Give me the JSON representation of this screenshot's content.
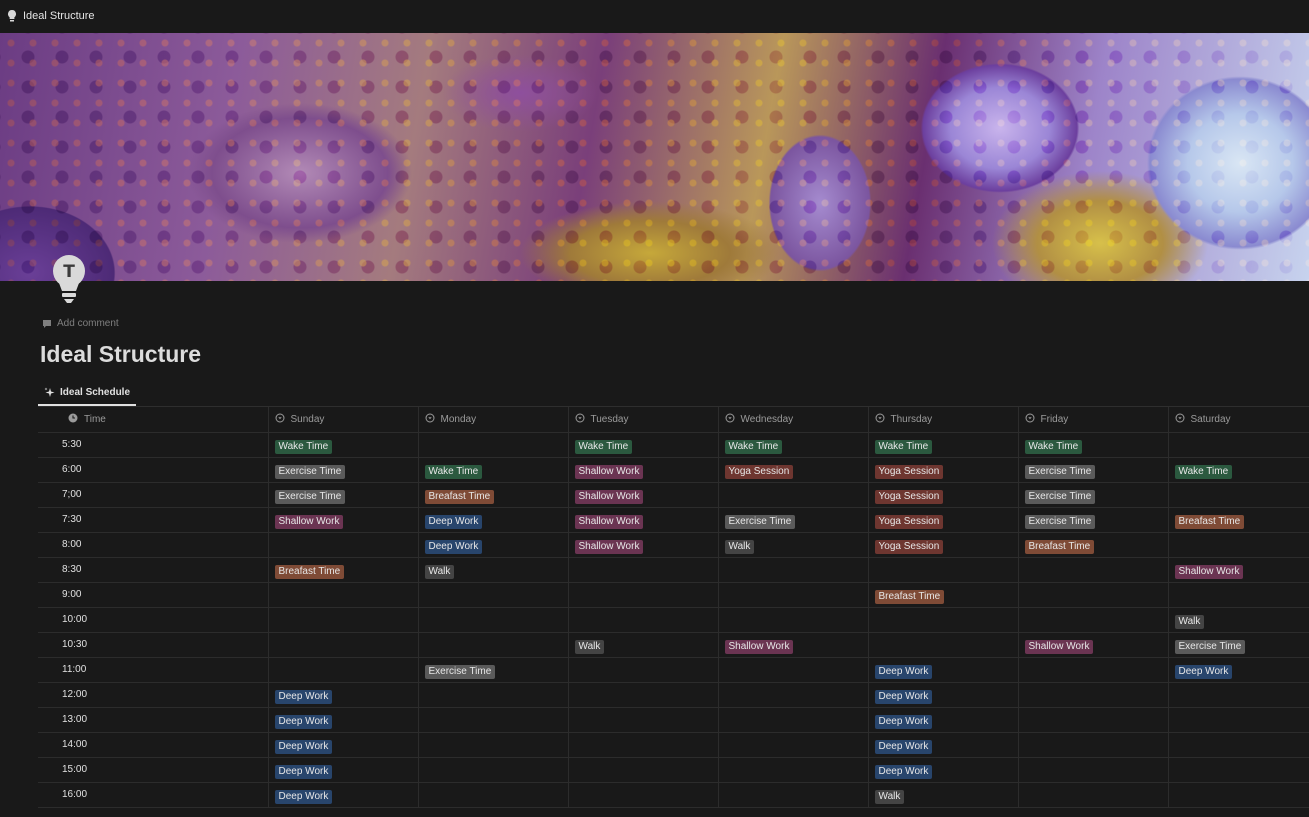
{
  "topbar": {
    "title": "Ideal Structure"
  },
  "page": {
    "icon_letter": "T",
    "add_comment": "Add comment",
    "title": "Ideal Structure",
    "view_tab": "Ideal Schedule"
  },
  "colors": {
    "background": "#191919",
    "Wake Time": "#2b593f",
    "Exercise Time": "#5a5a5a",
    "Shallow Work": "#6b3452",
    "Deep Work": "#28456c",
    "Breafast Time": "#7f4b36",
    "Yoga Session": "#6e3630",
    "Walk": "#444444"
  },
  "table": {
    "columns": [
      "Time",
      "Sunday",
      "Monday",
      "Tuesday",
      "Wednesday",
      "Thursday",
      "Friday",
      "Saturday"
    ],
    "rows": [
      {
        "time": "5:30",
        "cells": [
          "Wake Time",
          "",
          "Wake Time",
          "Wake Time",
          "Wake Time",
          "Wake Time",
          ""
        ]
      },
      {
        "time": "6:00",
        "cells": [
          "Exercise Time",
          "Wake Time",
          "Shallow Work",
          "Yoga Session",
          "Yoga Session",
          "Exercise Time",
          "Wake Time"
        ]
      },
      {
        "time": "7;00",
        "cells": [
          "Exercise Time",
          "Breafast Time",
          "Shallow Work",
          "",
          "Yoga Session",
          "Exercise Time",
          ""
        ]
      },
      {
        "time": "7:30",
        "cells": [
          "Shallow Work",
          "Deep Work",
          "Shallow Work",
          "Exercise Time",
          "Yoga Session",
          "Exercise Time",
          "Breafast Time"
        ]
      },
      {
        "time": "8:00",
        "cells": [
          "",
          "Deep Work",
          "Shallow Work",
          "Walk",
          "Yoga Session",
          "Breafast Time",
          ""
        ]
      },
      {
        "time": "8:30",
        "cells": [
          "Breafast Time",
          "Walk",
          "",
          "",
          "",
          "",
          "Shallow Work"
        ]
      },
      {
        "time": "9:00",
        "cells": [
          "",
          "",
          "",
          "",
          "Breafast Time",
          "",
          ""
        ]
      },
      {
        "time": "10:00",
        "cells": [
          "",
          "",
          "",
          "",
          "",
          "",
          "Walk"
        ]
      },
      {
        "time": "10:30",
        "cells": [
          "",
          "",
          "Walk",
          "Shallow Work",
          "",
          "Shallow Work",
          "Exercise Time"
        ]
      },
      {
        "time": "11:00",
        "cells": [
          "",
          "Exercise Time",
          "",
          "",
          "Deep Work",
          "",
          "Deep Work"
        ]
      },
      {
        "time": "12:00",
        "cells": [
          "Deep Work",
          "",
          "",
          "",
          "Deep Work",
          "",
          ""
        ]
      },
      {
        "time": "13:00",
        "cells": [
          "Deep Work",
          "",
          "",
          "",
          "Deep Work",
          "",
          ""
        ]
      },
      {
        "time": "14:00",
        "cells": [
          "Deep Work",
          "",
          "",
          "",
          "Deep Work",
          "",
          ""
        ]
      },
      {
        "time": "15:00",
        "cells": [
          "Deep Work",
          "",
          "",
          "",
          "Deep Work",
          "",
          ""
        ]
      },
      {
        "time": "16:00",
        "cells": [
          "Deep Work",
          "",
          "",
          "",
          "Walk",
          "",
          ""
        ]
      }
    ]
  }
}
